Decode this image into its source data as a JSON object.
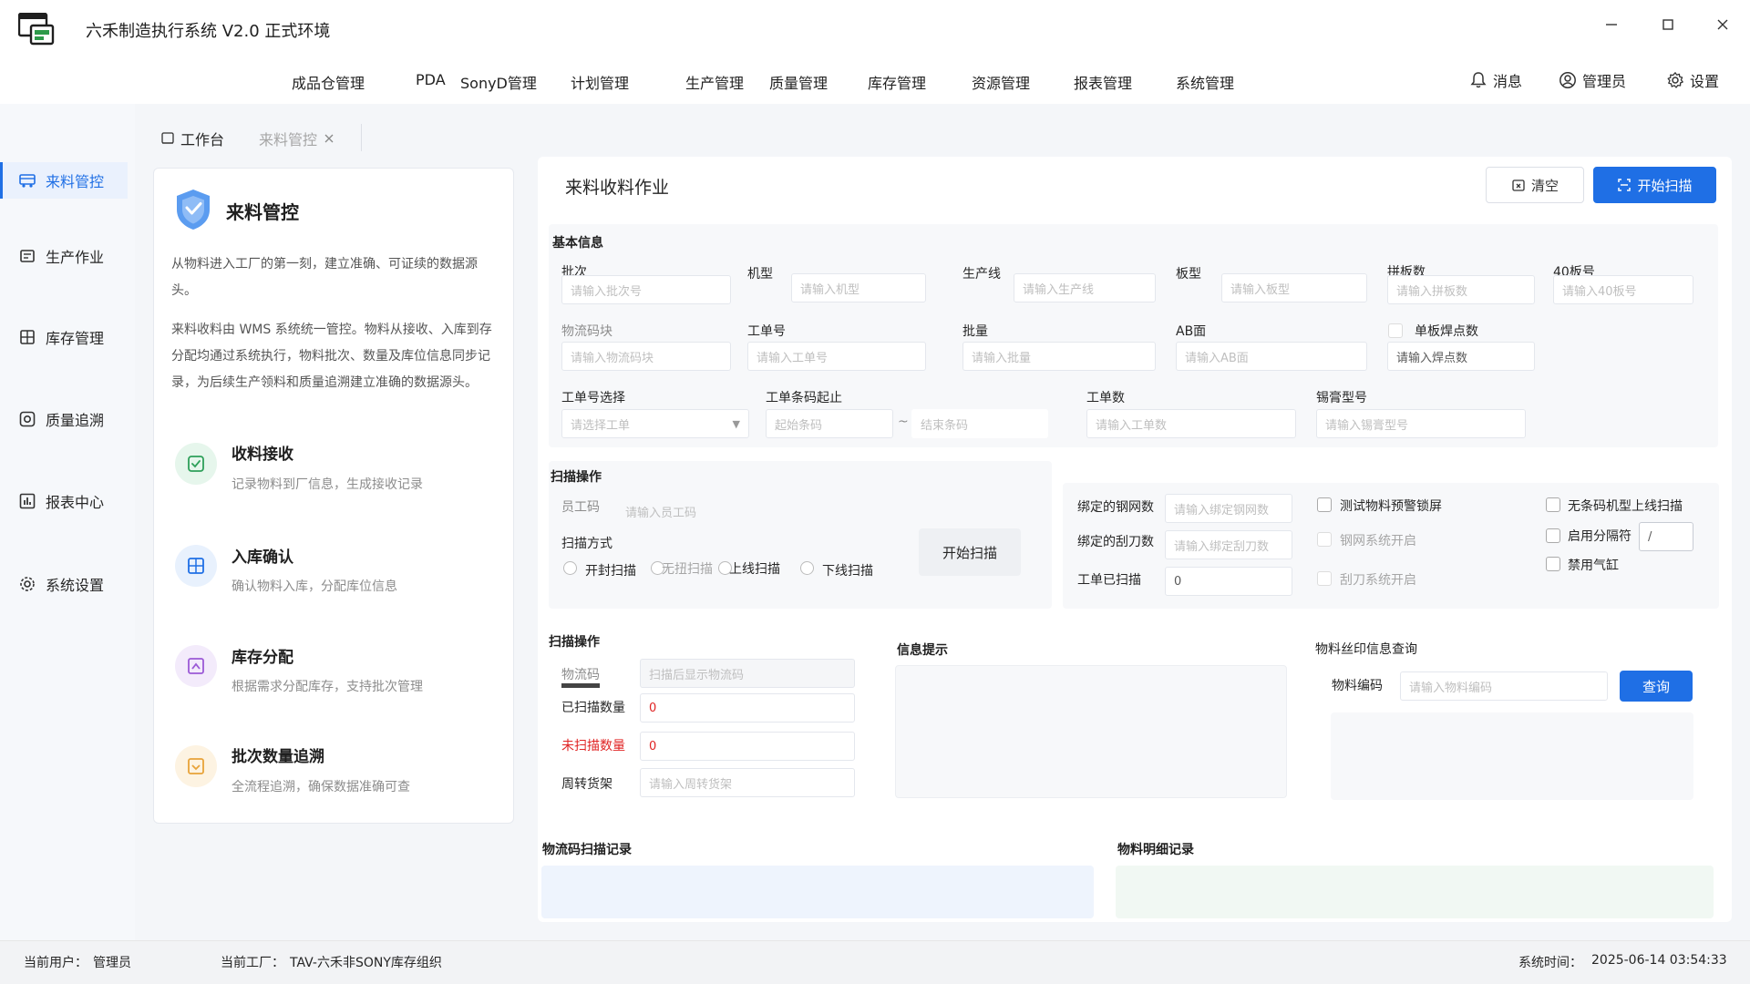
{
  "window": {
    "title": "六禾制造执行系统 V2.0 正式环境"
  },
  "menu": {
    "items": [
      "成品仓管理",
      "PDA",
      "SonyD管理",
      "计划管理",
      "生产管理",
      "质量管理",
      "库存管理",
      "资源管理",
      "报表管理",
      "系统管理"
    ],
    "actions": {
      "messages": "消息",
      "user": "管理员",
      "settings": "设置"
    }
  },
  "sidebar": {
    "items": [
      "来料管控",
      "生产作业",
      "库存管理",
      "质量追溯",
      "报表中心",
      "系统设置"
    ]
  },
  "tabs": {
    "workbench": "工作台",
    "current": "来料管控"
  },
  "info_card": {
    "title": "来料管控",
    "intro": "从物料进入工厂的第一刻，建立准确、可证续的数据源头。",
    "description": "来料收料由 WMS 系统统一管控。物料从接收、入库到存分配均通过系统执行，物料批次、数量及库位信息同步记录，为后续生产领料和质量追溯建立准确的数据源头。",
    "features": [
      {
        "title": "收料接收",
        "desc": "记录物料到厂信息，生成接收记录"
      },
      {
        "title": "入库确认",
        "desc": "确认物料入库，分配库位信息"
      },
      {
        "title": "库存分配",
        "desc": "根据需求分配库存，支持批次管理"
      },
      {
        "title": "批次数量追溯",
        "desc": "全流程追溯，确保数据准确可查"
      }
    ]
  },
  "main": {
    "title": "来料收料作业",
    "clear_button": "清空",
    "start_scan_button": "开始扫描"
  },
  "basic_info": {
    "section": "基本信息",
    "batch": {
      "label": "批次",
      "placeholder": "请输入批次号"
    },
    "model": {
      "label": "机型",
      "placeholder": "请输入机型"
    },
    "line": {
      "label": "生产线",
      "placeholder": "请输入生产线"
    },
    "board_type": {
      "label": "板型",
      "placeholder": "请输入板型"
    },
    "panel_count": {
      "label": "拼板数",
      "placeholder": "请输入拼板数"
    },
    "board40": {
      "label": "40板号",
      "placeholder": "请输入40板号"
    },
    "logistics_block": {
      "label": "物流码块",
      "placeholder": "请输入物流码块"
    },
    "work_order": {
      "label": "工单号",
      "placeholder": "请输入工单号"
    },
    "quantity": {
      "label": "批量",
      "placeholder": "请输入批量"
    },
    "ab_side": {
      "label": "AB面",
      "placeholder": "请输入AB面"
    },
    "solder_points": {
      "label": "单板焊点数",
      "placeholder": "请输入焊点数"
    },
    "work_order_select": {
      "label": "工单号选择",
      "placeholder": "请选择工单"
    },
    "barcode_range": {
      "label": "工单条码起止",
      "start_placeholder": "起始条码",
      "separator": "~",
      "end_placeholder": "结束条码"
    },
    "work_order_count": {
      "label": "工单数",
      "placeholder": "请输入工单数"
    },
    "solder_paste": {
      "label": "锡膏型号",
      "placeholder": "请输入锡膏型号"
    }
  },
  "scan_ops": {
    "section": "扫描操作",
    "employee": {
      "label": "员工码",
      "placeholder": "请输入员工码"
    },
    "scan_mode_label": "扫描方式",
    "modes": [
      "开封扫描",
      "无扭扫描",
      "上线扫描",
      "下线扫描"
    ],
    "start_button": "开始扫描",
    "bound_stencil": {
      "label": "绑定的钢网数",
      "placeholder": "请输入绑定钢网数"
    },
    "bound_blade": {
      "label": "绑定的刮刀数",
      "placeholder": "请输入绑定刮刀数"
    },
    "scanned_orders": {
      "label": "工单已扫描",
      "value": "0"
    },
    "checks_mid": [
      "测试物料预警锁屏",
      "钢网系统开启",
      "刮刀系统开启"
    ],
    "checks_right": [
      "无条码机型上线扫描",
      "启用分隔符",
      "禁用气缸"
    ],
    "separator_value": "/"
  },
  "scan_result": {
    "section": "扫描操作",
    "logistics_code": {
      "label": "物流码",
      "placeholder": "扫描后显示物流码"
    },
    "scanned_qty": {
      "label": "已扫描数量",
      "value": "0"
    },
    "unscanned_qty": {
      "label": "未扫描数量",
      "value": "0"
    },
    "rack": {
      "label": "周转货架",
      "placeholder": "请输入周转货架"
    }
  },
  "info_tips": {
    "title": "信息提示"
  },
  "silk_query": {
    "title": "物料丝印信息查询",
    "code_label": "物料编码",
    "code_placeholder": "请输入物料编码",
    "query_button": "查询"
  },
  "records": {
    "logistics_title": "物流码扫描记录",
    "material_title": "物料明细记录"
  },
  "status": {
    "user_label": "当前用户：",
    "user_value": "管理员",
    "factory_label": "当前工厂：",
    "factory_value": "TAV-六禾非SONY库存组织",
    "time_label": "系统时间：",
    "time_value": "2025-06-14 03:54:33"
  },
  "colors": {
    "primary": "#1f6fe5",
    "danger": "#e02424",
    "sidebar_bg": "#f6f8fb"
  }
}
